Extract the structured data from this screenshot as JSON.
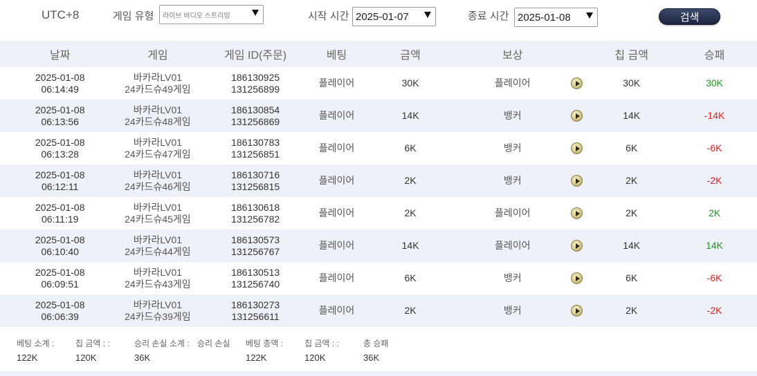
{
  "filter": {
    "timezone": "UTC+8",
    "game_type_label": "게임 유형",
    "game_type_value": "라이브 비디오 스트리밍",
    "start_label": "시작 시간",
    "start_value": "2025-01-07",
    "end_label": "종료 시간",
    "end_value": "2025-01-08",
    "search_label": "검색"
  },
  "table": {
    "headers": [
      "날짜",
      "게임",
      "게임 ID(주문)",
      "베팅",
      "금액",
      "보상",
      "칩 금액",
      "승패"
    ],
    "rows": [
      {
        "date": "2025-01-08",
        "time": "06:14:49",
        "game1": "바카라LV01",
        "game2": "24카드슈49게임",
        "id1": "186130925",
        "id2": "131256899",
        "bet": "플레이어",
        "amount": "30K",
        "reward": "플레이어",
        "chip": "30K",
        "winloss": "30K"
      },
      {
        "date": "2025-01-08",
        "time": "06:13:56",
        "game1": "바카라LV01",
        "game2": "24카드슈48게임",
        "id1": "186130854",
        "id2": "131256869",
        "bet": "플레이어",
        "amount": "14K",
        "reward": "뱅커",
        "chip": "14K",
        "winloss": "-14K"
      },
      {
        "date": "2025-01-08",
        "time": "06:13:28",
        "game1": "바카라LV01",
        "game2": "24카드슈47게임",
        "id1": "186130783",
        "id2": "131256851",
        "bet": "플레이어",
        "amount": "6K",
        "reward": "뱅커",
        "chip": "6K",
        "winloss": "-6K"
      },
      {
        "date": "2025-01-08",
        "time": "06:12:11",
        "game1": "바카라LV01",
        "game2": "24카드슈46게임",
        "id1": "186130716",
        "id2": "131256815",
        "bet": "플레이어",
        "amount": "2K",
        "reward": "뱅커",
        "chip": "2K",
        "winloss": "-2K"
      },
      {
        "date": "2025-01-08",
        "time": "06:11:19",
        "game1": "바카라LV01",
        "game2": "24카드슈45게임",
        "id1": "186130618",
        "id2": "131256782",
        "bet": "플레이어",
        "amount": "2K",
        "reward": "플레이어",
        "chip": "2K",
        "winloss": "2K"
      },
      {
        "date": "2025-01-08",
        "time": "06:10:40",
        "game1": "바카라LV01",
        "game2": "24카드슈44게임",
        "id1": "186130573",
        "id2": "131256767",
        "bet": "플레이어",
        "amount": "14K",
        "reward": "플레이어",
        "chip": "14K",
        "winloss": "14K"
      },
      {
        "date": "2025-01-08",
        "time": "06:09:51",
        "game1": "바카라LV01",
        "game2": "24카드슈43게임",
        "id1": "186130513",
        "id2": "131256740",
        "bet": "플레이어",
        "amount": "6K",
        "reward": "뱅커",
        "chip": "6K",
        "winloss": "-6K"
      },
      {
        "date": "2025-01-08",
        "time": "06:06:39",
        "game1": "바카라LV01",
        "game2": "24카드슈39게임",
        "id1": "186130273",
        "id2": "131256611",
        "bet": "플레이어",
        "amount": "2K",
        "reward": "뱅커",
        "chip": "2K",
        "winloss": "-2K"
      }
    ]
  },
  "summary": {
    "labels": [
      "베팅 소계 :",
      "칩 금액 : :",
      "승리 손실 소계 :",
      "승리 손실",
      "베팅 총액 :",
      "칩 금액 : :",
      "총 승패"
    ],
    "values": [
      "122K",
      "120K",
      "36K",
      "122K",
      "120K",
      "36K"
    ]
  },
  "colors": {
    "positive": "#1a9a1a",
    "negative": "#e02020",
    "row_alt": "#eef1f7",
    "search_button": "#1c2540"
  },
  "icons": {
    "dropdown": "triangle-down",
    "play": "play-circle"
  }
}
